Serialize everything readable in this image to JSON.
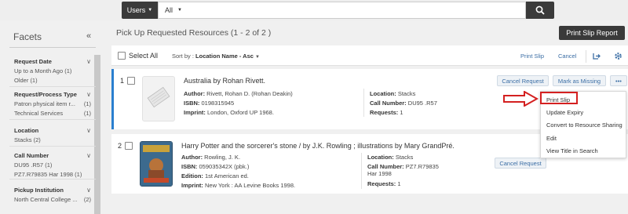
{
  "search": {
    "scope_label": "Users",
    "filter_value": "All"
  },
  "facets": {
    "title": "Facets",
    "groups": [
      {
        "label": "Request Date",
        "items": [
          {
            "label": "Up to a Month Ago",
            "count": "(1)"
          },
          {
            "label": "Older",
            "count": "(1)"
          }
        ]
      },
      {
        "label": "Request/Process Type",
        "items": [
          {
            "label": "Patron physical item r...",
            "count": "(1)"
          },
          {
            "label": "Technical Services",
            "count": "(1)"
          }
        ]
      },
      {
        "label": "Location",
        "items": [
          {
            "label": "Stacks",
            "count": "(2)"
          }
        ]
      },
      {
        "label": "Call Number",
        "items": [
          {
            "label": "DU95 .R57",
            "count": "(1)"
          },
          {
            "label": "PZ7.R79835 Har 1998",
            "count": "(1)"
          }
        ]
      },
      {
        "label": "Pickup Institution",
        "items": [
          {
            "label": "North Central College ...",
            "count": "(2)"
          }
        ]
      }
    ]
  },
  "main": {
    "title": "Pick Up Requested Resources (1 - 2 of 2 )",
    "print_report_label": "Print Slip Report",
    "toolbar": {
      "select_all": "Select All",
      "sort_prefix": "Sort by :",
      "sort_value": "Location Name - Asc",
      "print_slip": "Print Slip",
      "cancel": "Cancel"
    },
    "rows": [
      {
        "num": "1",
        "title": "Australia by Rohan Rivett.",
        "author_label": "Author:",
        "author": "Rivett, Rohan D. (Rohan Deakin)",
        "isbn_label": "ISBN:",
        "isbn": "0198315945",
        "imprint_label": "Imprint:",
        "imprint": "London, Oxford UP 1968.",
        "location_label": "Location:",
        "location": "Stacks",
        "callno_label": "Call Number:",
        "callno": "DU95 .R57",
        "requests_label": "Requests:",
        "requests": "1",
        "cancel_request": "Cancel Request",
        "mark_missing": "Mark as Missing",
        "more": "•••"
      },
      {
        "num": "2",
        "title": "Harry Potter and the sorcerer's stone / by J.K. Rowling ; illustrations by Mary GrandPré.",
        "author_label": "Author:",
        "author": "Rowling, J. K.",
        "isbn_label": "ISBN:",
        "isbn": "059035342X (pbk.)",
        "edition_label": "Edition:",
        "edition": "1st American ed.",
        "imprint_label": "Imprint:",
        "imprint": "New York : AA Levine Books 1998.",
        "location_label": "Location:",
        "location": "Stacks",
        "callno_label": "Call Number:",
        "callno": "PZ7.R79835",
        "callno2": "Har 1998",
        "requests_label": "Requests:",
        "requests": "1",
        "cancel_request": "Cancel Request"
      }
    ],
    "menu": [
      "Print Slip",
      "Update Expiry",
      "Convert to Resource Sharing",
      "Edit",
      "View Title in Search"
    ]
  },
  "colors": {
    "accent": "#2a7fcf",
    "link": "#3b6ea5",
    "dark_button": "#3a3a3a",
    "highlight_red": "#d42020"
  },
  "icons": {
    "search": "search-icon",
    "export": "export-icon",
    "settings": "gear-icon",
    "collapse": "double-chevron-left-icon",
    "book_placeholder": "book-icon",
    "cover": "book-cover-image"
  }
}
